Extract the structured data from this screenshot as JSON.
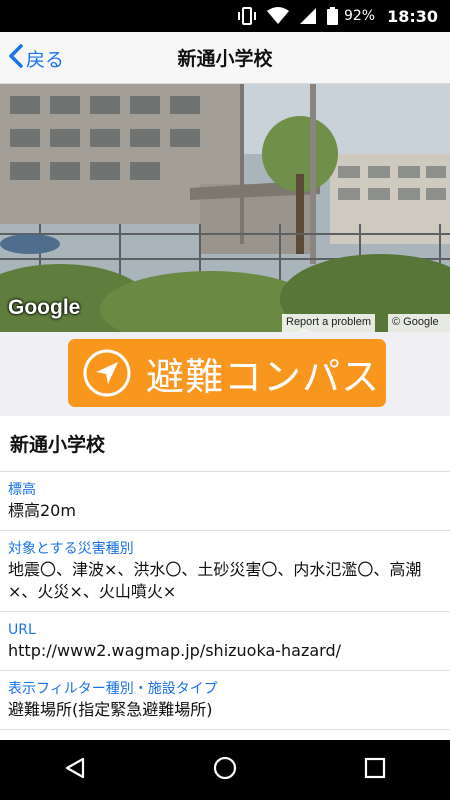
{
  "status_bar": {
    "battery_percent": "92%",
    "time": "18:30",
    "icons": [
      "vibrate-icon",
      "wifi-icon",
      "signal-icon",
      "battery-icon"
    ]
  },
  "nav": {
    "back_label": "戻る",
    "title": "新通小学校"
  },
  "street_view": {
    "logo_text": "Google",
    "report_label": "Report a problem",
    "copyright": "© Google"
  },
  "compass": {
    "label": "避難コンパス",
    "icon": "navigation-arrow-icon",
    "color": "#f8961e"
  },
  "details": {
    "title": "新通小学校",
    "rows": [
      {
        "label": "標高",
        "value": "標高20m"
      },
      {
        "label": "対象とする災害種別",
        "value": "地震〇、津波×、洪水〇、土砂災害〇、内水氾濫〇、高潮×、火災×、火山噴火×"
      },
      {
        "label": "URL",
        "value": "http://www2.wagmap.jp/shizuoka-hazard/"
      },
      {
        "label": "表示フィルター種別・施設タイプ",
        "value": "避難場所(指定緊急避難場所)"
      }
    ]
  },
  "android_nav": {
    "icons": [
      "back-triangle-icon",
      "home-circle-icon",
      "recents-square-icon"
    ]
  },
  "colors": {
    "accent": "#1a73e8",
    "compass_button": "#f8961e"
  }
}
